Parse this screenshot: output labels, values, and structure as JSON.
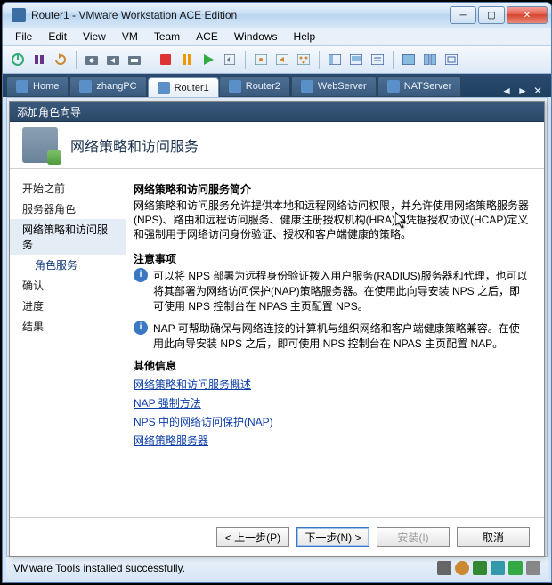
{
  "window": {
    "title": "Router1 - VMware Workstation ACE Edition"
  },
  "menu": {
    "items": [
      "File",
      "Edit",
      "View",
      "VM",
      "Team",
      "ACE",
      "Windows",
      "Help"
    ]
  },
  "tabs": {
    "items": [
      {
        "label": "Home",
        "active": false
      },
      {
        "label": "zhangPC",
        "active": false
      },
      {
        "label": "Router1",
        "active": true
      },
      {
        "label": "Router2",
        "active": false
      },
      {
        "label": "WebServer",
        "active": false
      },
      {
        "label": "NATServer",
        "active": false
      }
    ]
  },
  "wizard": {
    "title": "添加角色向导",
    "heading": "网络策略和访问服务",
    "nav": {
      "items": [
        "开始之前",
        "服务器角色",
        "网络策略和访问服务"
      ],
      "sub": [
        "角色服务"
      ],
      "items2": [
        "确认",
        "进度",
        "结果"
      ],
      "selectedIndex": 2
    },
    "main": {
      "intro_title": "网络策略和访问服务简介",
      "intro_text": "网络策略和访问服务允许提供本地和远程网络访问权限，并允许使用网络策略服务器(NPS)、路由和远程访问服务、健康注册授权机构(HRA)和凭据授权协议(HCAP)定义和强制用于网络访问身份验证、授权和客户端健康的策略。",
      "notes_title": "注意事项",
      "note1": "可以将 NPS 部署为远程身份验证拨入用户服务(RADIUS)服务器和代理，也可以将其部署为网络访问保护(NAP)策略服务器。在使用此向导安装 NPS 之后，即可使用 NPS 控制台在 NPAS 主页配置 NPS。",
      "note2": "NAP 可帮助确保与网络连接的计算机与组织网络和客户端健康策略兼容。在使用此向导安装 NPS 之后，即可使用 NPS 控制台在 NPAS 主页配置 NAP。",
      "other_title": "其他信息",
      "links": [
        "网络策略和访问服务概述",
        "NAP 强制方法",
        "NPS 中的网络访问保护(NAP)",
        "网络策略服务器"
      ]
    },
    "buttons": {
      "prev": "< 上一步(P)",
      "next": "下一步(N) >",
      "install": "安装(I)",
      "cancel": "取消"
    }
  },
  "status": {
    "text": "VMware Tools installed successfully."
  }
}
